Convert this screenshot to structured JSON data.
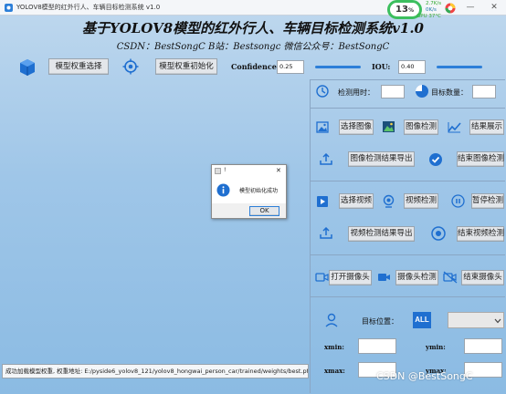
{
  "window": {
    "title": "YOLOV8模型的红外行人、车辆目标检测系统 v1.0",
    "minimize": "—",
    "close": "✕"
  },
  "system_widget": {
    "cpu_percent": "13",
    "cpu_unit": "%",
    "net_up": "2.7K/s",
    "net_down": "0K/s",
    "gpu": "GPU 37°C"
  },
  "header": {
    "title": "基于YOLOV8模型的红外行人、车辆目标检测系统v1.0",
    "subtitle": "CSDN：BestSongC   B站：Bestsongc   微信公众号：BestSongC"
  },
  "toolbar": {
    "select_weights_label": "模型权重选择",
    "init_weights_label": "模型权重初始化",
    "confidence_label": "Confidence:",
    "confidence_value": "0.25",
    "confidence_level": 0.25,
    "iou_label": "IOU:",
    "iou_value": "0.40",
    "iou_level": 0.4
  },
  "stats_panel": {
    "detect_time_label": "检测用时：",
    "detect_time_value": "",
    "target_count_label": "目标数量：",
    "target_count_value": ""
  },
  "image_panel": {
    "select_image_label": "选择图像",
    "image_detect_label": "图像检测",
    "show_result_label": "结果展示",
    "export_image_label": "图像检测结果导出",
    "stop_image_label": "结束图像检测"
  },
  "video_panel": {
    "select_video_label": "选择视频",
    "video_detect_label": "视频检测",
    "pause_label": "暂停检测",
    "export_video_label": "视频检测结果导出",
    "stop_video_label": "结束视频检测"
  },
  "camera_panel": {
    "open_camera_label": "打开摄像头",
    "camera_detect_label": "摄像头检测",
    "stop_camera_label": "结束摄像头"
  },
  "location_panel": {
    "target_pos_label": "目标位置：",
    "all_label": "ALL",
    "xmin_label": "xmin:",
    "ymin_label": "ymin:",
    "xmax_label": "xmax:",
    "ymax_label": "ymax:"
  },
  "status_bar": {
    "text": "成功加载模型权重, 权重地址: E:/pyside6_yolov8_121/yolov8_hongwai_person_car/trained/weights/best.pt"
  },
  "dialog": {
    "title": "!",
    "message": "模型初始化成功",
    "ok_label": "OK",
    "close": "✕"
  },
  "watermark": "CSDN @BestSongC",
  "colors": {
    "accent_blue": "#2d7fd8",
    "icon_blue": "#1f6fd0",
    "cpu_ring": "#3cbf5e"
  }
}
